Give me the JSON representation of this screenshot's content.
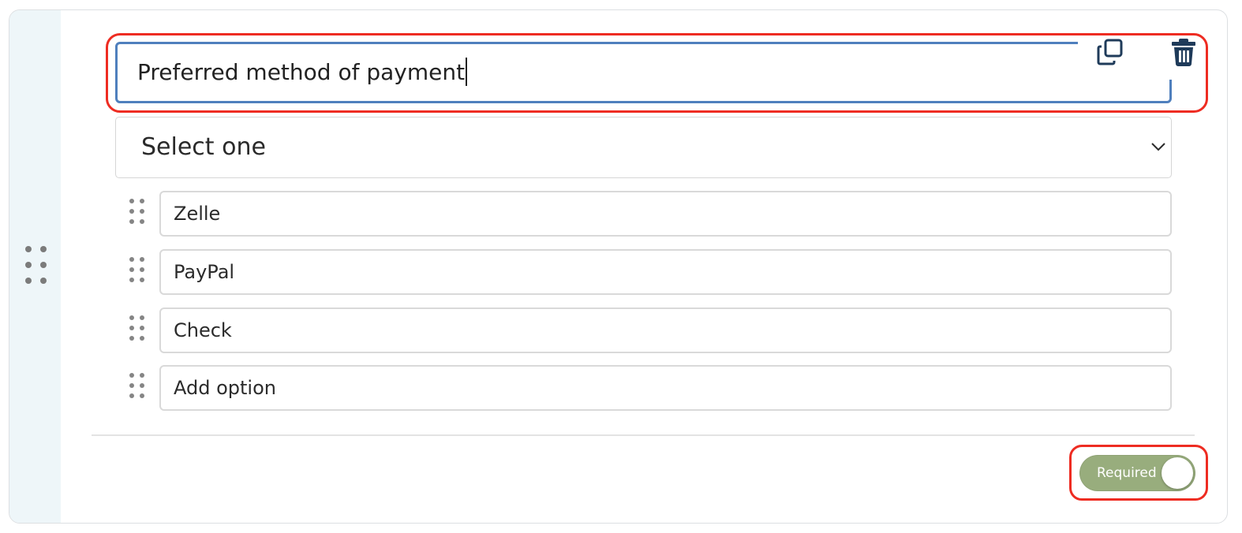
{
  "question": {
    "title": "Preferred method of payment"
  },
  "answer_type": {
    "selected": "Select one"
  },
  "options": [
    {
      "label": "Zelle"
    },
    {
      "label": "PayPal"
    },
    {
      "label": "Check"
    },
    {
      "label": "Add option"
    }
  ],
  "footer": {
    "required_label": "Required",
    "required_on": true
  },
  "colors": {
    "input_focus_border": "#4f7fbd",
    "highlight": "#ee2c22",
    "toggle_on": "#98ad7d",
    "icon": "#1f3b5a",
    "rail": "#eef6f9"
  },
  "icons": {
    "copy": "copy-icon",
    "trash": "trash-icon",
    "chevron": "chevron-down-icon",
    "drag": "drag-handle-icon"
  }
}
